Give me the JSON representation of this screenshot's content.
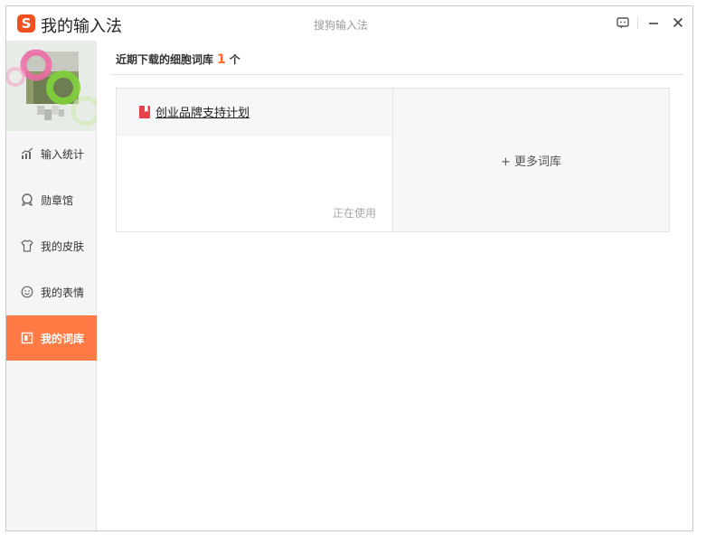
{
  "titlebar": {
    "logo_letter": "S",
    "app_title": "我的输入法",
    "center_title": "搜狗输入法",
    "icons": [
      "feedback-icon",
      "minimize-icon",
      "close-icon"
    ]
  },
  "sidebar": {
    "items": [
      {
        "label": "输入统计",
        "icon": "stats-icon"
      },
      {
        "label": "勋章馆",
        "icon": "medal-icon"
      },
      {
        "label": "我的皮肤",
        "icon": "shirt-icon"
      },
      {
        "label": "我的表情",
        "icon": "smiley-icon"
      },
      {
        "label": "我的词库",
        "icon": "dictionary-icon",
        "active": true
      }
    ]
  },
  "main": {
    "header_text": "近期下载的细胞词库",
    "count": "1",
    "count_unit": "个",
    "cards": [
      {
        "title": "创业品牌支持计划",
        "status": "正在使用"
      }
    ],
    "more_label": "+ 更多词库"
  },
  "colors": {
    "accent": "#ff7a45",
    "logo": "#f04f1f",
    "count": "#ff6a2f"
  }
}
